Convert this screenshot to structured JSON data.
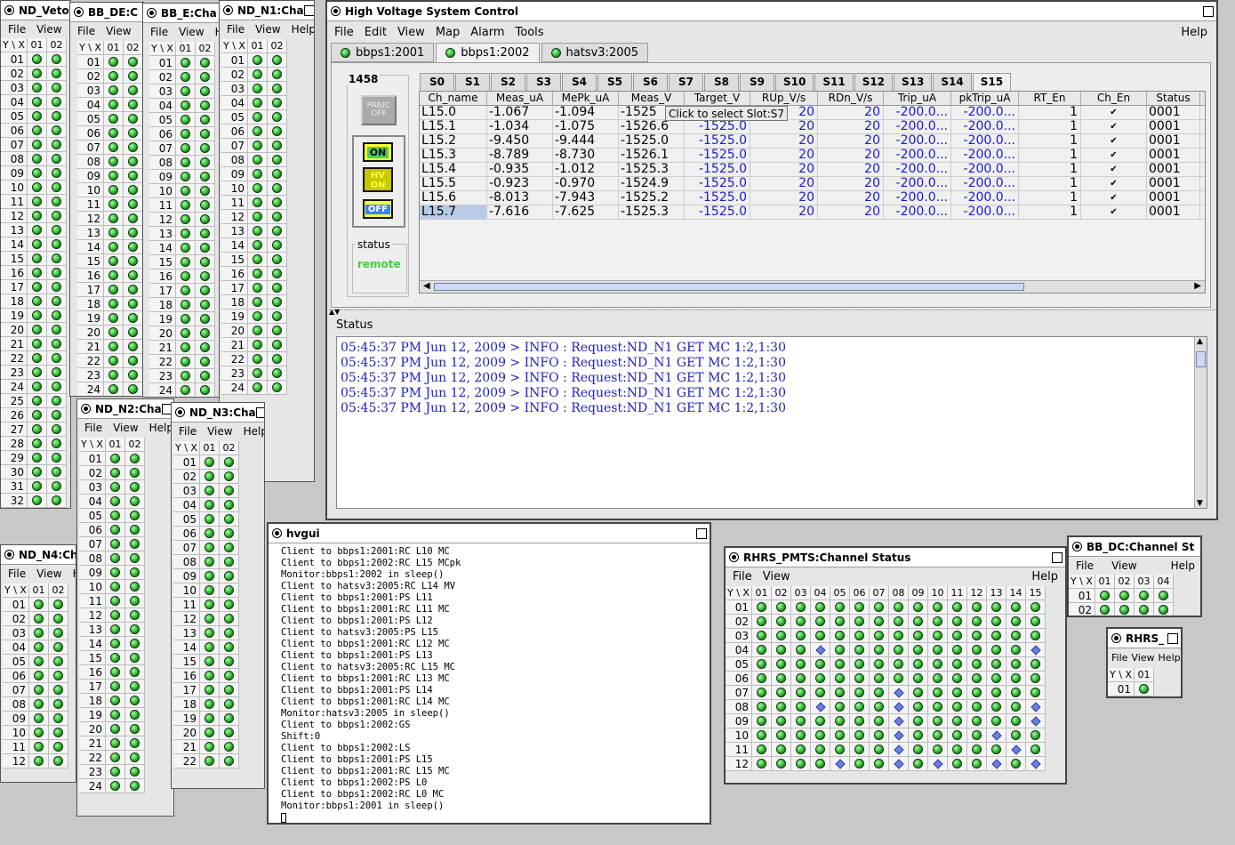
{
  "bg_windows": {
    "nd_veto": {
      "title": "ND_Veto:",
      "menu": [
        "File",
        "View",
        "H"
      ],
      "corner": "Y \\ X",
      "cols": [
        "01",
        "02"
      ],
      "rows": [
        "01",
        "02",
        "03",
        "04",
        "05",
        "06",
        "07",
        "08",
        "09",
        "10",
        "11",
        "12",
        "13",
        "14",
        "15",
        "16",
        "17",
        "18",
        "19",
        "20",
        "21",
        "22",
        "23",
        "24",
        "25",
        "26",
        "27",
        "28",
        "29",
        "30",
        "31",
        "32"
      ]
    },
    "bb_de": {
      "title": "BB_DE:C",
      "menu": [
        "File",
        "View",
        "He"
      ],
      "corner": "Y \\ X",
      "cols": [
        "01",
        "02"
      ],
      "rows": [
        "01",
        "02",
        "03",
        "04",
        "05",
        "06",
        "07",
        "08",
        "09",
        "10",
        "11",
        "12",
        "13",
        "14",
        "15",
        "16",
        "17",
        "18",
        "19",
        "20",
        "21",
        "22",
        "23",
        "24"
      ]
    },
    "bb_e": {
      "title": "BB_E:Cha",
      "menu": [
        "File",
        "View",
        "He"
      ],
      "corner": "Y \\ X",
      "cols": [
        "01",
        "02"
      ],
      "rows": [
        "01",
        "02",
        "03",
        "04",
        "05",
        "06",
        "07",
        "08",
        "09",
        "10",
        "11",
        "12",
        "13",
        "14",
        "15",
        "16",
        "17",
        "18",
        "19",
        "20",
        "21",
        "22",
        "23",
        "24"
      ]
    },
    "nd_n1": {
      "title": "ND_N1:Cha",
      "menu": [
        "File",
        "View",
        "Help"
      ],
      "corner": "Y \\ X",
      "cols": [
        "01",
        "02"
      ],
      "rows": [
        "01",
        "02",
        "03",
        "04",
        "05",
        "06",
        "07",
        "08",
        "09",
        "10",
        "11",
        "12",
        "13",
        "14",
        "15",
        "16",
        "17",
        "18",
        "19",
        "20",
        "21",
        "22",
        "23",
        "24"
      ]
    },
    "nd_n2": {
      "title": "ND_N2:Cha",
      "menu": [
        "File",
        "View",
        "Help"
      ],
      "corner": "Y \\ X",
      "cols": [
        "01",
        "02"
      ],
      "rows": [
        "01",
        "02",
        "03",
        "04",
        "05",
        "06",
        "07",
        "08",
        "09",
        "10",
        "11",
        "12",
        "13",
        "14",
        "15",
        "16",
        "17",
        "18",
        "19",
        "20",
        "21",
        "22",
        "23",
        "24"
      ]
    },
    "nd_n3": {
      "title": "ND_N3:Cha",
      "menu": [
        "File",
        "View",
        "Help"
      ],
      "corner": "Y \\ X",
      "cols": [
        "01",
        "02"
      ],
      "rows": [
        "01",
        "02",
        "03",
        "04",
        "05",
        "06",
        "07",
        "08",
        "09",
        "10",
        "11",
        "12",
        "13",
        "14",
        "15",
        "16",
        "17",
        "18",
        "19",
        "20",
        "21",
        "22"
      ]
    },
    "nd_n4": {
      "title": "ND_N4:Ch",
      "menu": [
        "File",
        "View",
        "H"
      ],
      "corner": "Y \\ X",
      "cols": [
        "01",
        "02"
      ],
      "rows": [
        "01",
        "02",
        "03",
        "04",
        "05",
        "06",
        "07",
        "08",
        "09",
        "10",
        "11",
        "12"
      ]
    }
  },
  "hv": {
    "title": "High Voltage System Control",
    "menu": [
      "File",
      "Edit",
      "View",
      "Map",
      "Alarm",
      "Tools"
    ],
    "help": "Help",
    "crate_tabs": [
      "bbps1:2001",
      "bbps1:2002",
      "hatsv3:2005"
    ],
    "panel_label": "1458",
    "panic_label": "PANIC OFF",
    "on_label": "ON",
    "hvon_label": "HV ON",
    "off_label": "OFF",
    "status_label": "status",
    "status_value": "remote",
    "slot_tabs": [
      "S0",
      "S1",
      "S2",
      "S3",
      "S4",
      "S5",
      "S6",
      "S7",
      "S8",
      "S9",
      "S10",
      "S11",
      "S12",
      "S13",
      "S14",
      "S15"
    ],
    "columns": [
      "Ch_name",
      "Meas_uA",
      "MePk_uA",
      "Meas_V",
      "Target_V",
      "RUp_V/s",
      "RDn_V/s",
      "Trip_uA",
      "pkTrip_uA",
      "RT_En",
      "Ch_En",
      "Status"
    ],
    "rows": [
      [
        "L15.0",
        "-1.067",
        "-1.094",
        "-1525",
        "-1525.0",
        "20",
        "20",
        "-200.0...",
        "-200.0...",
        "1",
        "✔",
        "0001"
      ],
      [
        "L15.1",
        "-1.034",
        "-1.075",
        "-1526.6",
        "-1525.0",
        "20",
        "20",
        "-200.0...",
        "-200.0...",
        "1",
        "✔",
        "0001"
      ],
      [
        "L15.2",
        "-9.450",
        "-9.444",
        "-1525.0",
        "-1525.0",
        "20",
        "20",
        "-200.0...",
        "-200.0...",
        "1",
        "✔",
        "0001"
      ],
      [
        "L15.3",
        "-8.789",
        "-8.730",
        "-1526.1",
        "-1525.0",
        "20",
        "20",
        "-200.0...",
        "-200.0...",
        "1",
        "✔",
        "0001"
      ],
      [
        "L15.4",
        "-0.935",
        "-1.012",
        "-1525.3",
        "-1525.0",
        "20",
        "20",
        "-200.0...",
        "-200.0...",
        "1",
        "✔",
        "0001"
      ],
      [
        "L15.5",
        "-0.923",
        "-0.970",
        "-1524.9",
        "-1525.0",
        "20",
        "20",
        "-200.0...",
        "-200.0...",
        "1",
        "✔",
        "0001"
      ],
      [
        "L15.6",
        "-8.013",
        "-7.943",
        "-1525.2",
        "-1525.0",
        "20",
        "20",
        "-200.0...",
        "-200.0...",
        "1",
        "✔",
        "0001"
      ],
      [
        "L15.7",
        "-7.616",
        "-7.625",
        "-1525.3",
        "-1525.0",
        "20",
        "20",
        "-200.0...",
        "-200.0...",
        "1",
        "✔",
        "0001"
      ]
    ],
    "tooltip": "Click to select Slot:S7",
    "status_title": "Status",
    "log": [
      "05:45:37 PM Jun 12, 2009 > INFO : Request:ND_N1 GET MC 1:2,1:30",
      "05:45:37 PM Jun 12, 2009 > INFO : Request:ND_N1 GET MC 1:2,1:30",
      "05:45:37 PM Jun 12, 2009 > INFO : Request:ND_N1 GET MC 1:2,1:30",
      "05:45:37 PM Jun 12, 2009 > INFO : Request:ND_N1 GET MC 1:2,1:30",
      "05:45:37 PM Jun 12, 2009 > INFO : Request:ND_N1 GET MC 1:2,1:30"
    ]
  },
  "hvgui": {
    "title": "hvgui",
    "lines": [
      "Client to bbps1:2001:RC L10 MC",
      "Client to bbps1:2002:RC L15 MCpk",
      "Monitor:bbps1:2002 in sleep()",
      "Client to hatsv3:2005:RC L14 MV",
      "Client to bbps1:2001:PS L11",
      "Client to bbps1:2001:RC L11 MC",
      "Client to bbps1:2001:PS L12",
      "Client to hatsv3:2005:PS L15",
      "Client to bbps1:2001:RC L12 MC",
      "Client to bbps1:2001:PS L13",
      "Client to hatsv3:2005:RC L15 MC",
      "Client to bbps1:2001:RC L13 MC",
      "Client to bbps1:2001:PS L14",
      "Client to bbps1:2001:RC L14 MC",
      "Monitor:hatsv3:2005 in sleep()",
      "Client to bbps1:2002:GS",
      "Shift:0",
      "Client to bbps1:2002:LS",
      "Client to bbps1:2001:PS L15",
      "Client to bbps1:2001:RC L15 MC",
      "Client to bbps1:2002:PS L0",
      "Client to bbps1:2002:RC L0 MC",
      "Monitor:bbps1:2001 in sleep()"
    ]
  },
  "rhrs_pmts": {
    "title": "RHRS_PMTS:Channel Status",
    "menu": [
      "File",
      "View"
    ],
    "help": "Help",
    "corner": "Y \\ X",
    "cols": [
      "01",
      "02",
      "03",
      "04",
      "05",
      "06",
      "07",
      "08",
      "09",
      "10",
      "11",
      "12",
      "13",
      "14",
      "15"
    ],
    "rows": [
      "01",
      "02",
      "03",
      "04",
      "05",
      "06",
      "07",
      "08",
      "09",
      "10",
      "11",
      "12"
    ],
    "diamonds": [
      [
        4,
        4
      ],
      [
        4,
        15
      ],
      [
        7,
        8
      ],
      [
        8,
        4
      ],
      [
        8,
        8
      ],
      [
        8,
        15
      ],
      [
        9,
        8
      ],
      [
        9,
        15
      ],
      [
        10,
        8
      ],
      [
        10,
        13
      ],
      [
        11,
        8
      ],
      [
        11,
        14
      ],
      [
        12,
        5
      ],
      [
        12,
        8
      ],
      [
        12,
        10
      ],
      [
        12,
        13
      ],
      [
        12,
        15
      ]
    ]
  },
  "bb_dc": {
    "title": "BB_DC:Channel St",
    "menu": [
      "File",
      "View"
    ],
    "help": "Help",
    "corner": "Y \\ X",
    "cols": [
      "01",
      "02",
      "03",
      "04"
    ],
    "rows": [
      "01",
      "02"
    ]
  },
  "rhrs": {
    "title": "RHRS_",
    "menu": [
      "File",
      "View",
      "Help"
    ],
    "corner": "Y \\ X",
    "cols": [
      "01"
    ],
    "rows": [
      "01"
    ]
  },
  "colors": {
    "green_led": "#1f9a1f",
    "log_text": "#2020c0",
    "remote": "#3ad33a",
    "value_blue": "#1a1ad0"
  }
}
